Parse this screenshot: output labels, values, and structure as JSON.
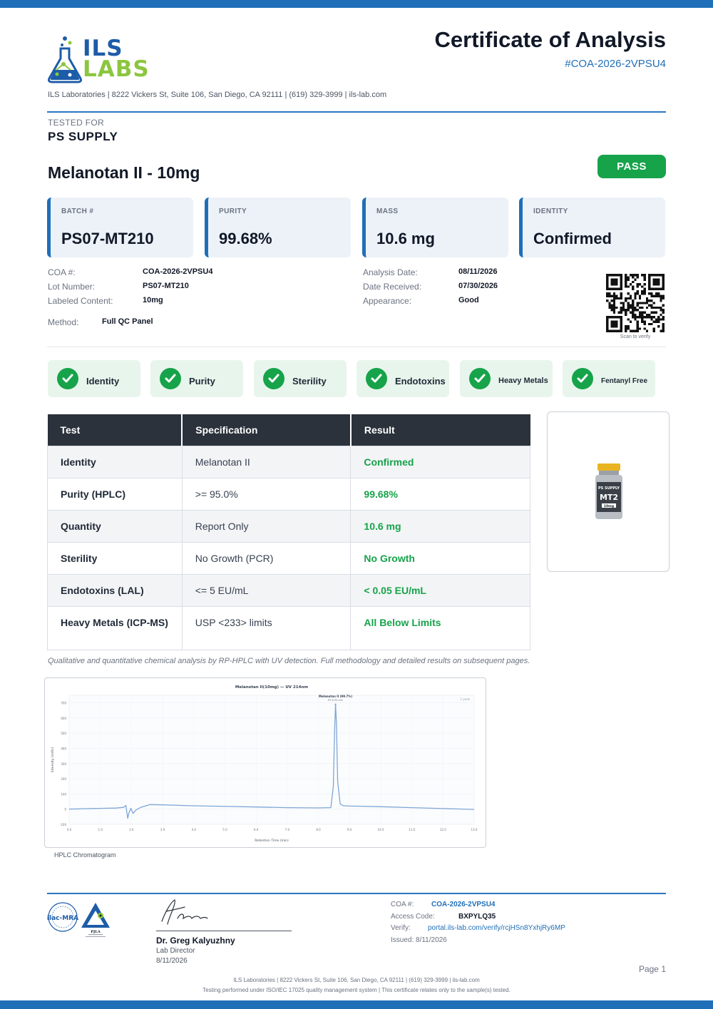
{
  "header": {
    "logo_primary": "ILS",
    "logo_secondary": "LABS",
    "address_line": "ILS Laboratories  |  8222 Vickers St, Suite 106, San Diego, CA 92111  |  (619) 329-3999  |  ils-lab.com",
    "title": "Certificate of Analysis",
    "coa_number": "#COA-2026-2VPSU4"
  },
  "client": {
    "label": "TESTED FOR",
    "name": "PS SUPPLY"
  },
  "product": {
    "name": "Melanotan II - 10mg",
    "status": "PASS"
  },
  "summary_cards": [
    {
      "label": "BATCH #",
      "value": "PS07-MT210"
    },
    {
      "label": "PURITY",
      "value": "99.68%"
    },
    {
      "label": "MASS",
      "value": "10.6 mg"
    },
    {
      "label": "IDENTITY",
      "value": "Confirmed"
    }
  ],
  "details_left": [
    {
      "key": "COA #:",
      "value": "COA-2026-2VPSU4"
    },
    {
      "key": "Lot Number:",
      "value": "PS07-MT210"
    },
    {
      "key": "Labeled Content:",
      "value": "10mg"
    }
  ],
  "method": {
    "key": "Method:",
    "value": "Full QC Panel"
  },
  "details_right": [
    {
      "key": "Analysis Date:",
      "value": "08/11/2026"
    },
    {
      "key": "Date Received:",
      "value": "07/30/2026"
    },
    {
      "key": "Appearance:",
      "value": "Good"
    }
  ],
  "qr_caption": "Scan to verify",
  "checks": [
    "Identity",
    "Purity",
    "Sterility",
    "Endotoxins",
    "Heavy Metals",
    "Fentanyl Free"
  ],
  "results_table": {
    "headers": [
      "Test",
      "Specification",
      "Result"
    ],
    "rows": [
      {
        "test": "Identity",
        "spec": "Melanotan II",
        "result": "Confirmed"
      },
      {
        "test": "Purity (HPLC)",
        "spec": ">= 95.0%",
        "result": "99.68%"
      },
      {
        "test": "Quantity",
        "spec": "Report Only",
        "result": "10.6 mg"
      },
      {
        "test": "Sterility",
        "spec": "No Growth (PCR)",
        "result": "No Growth"
      },
      {
        "test": "Endotoxins (LAL)",
        "spec": "<= 5 EU/mL",
        "result": "< 0.05 EU/mL"
      },
      {
        "test": "Heavy Metals (ICP-MS)",
        "spec": "USP <233> limits",
        "result": "All Below Limits"
      }
    ]
  },
  "vial": {
    "brand": "PS SUPPLY",
    "code": "MT2",
    "dose": "10mg"
  },
  "footnote": "Qualitative and quantitative chemical analysis by RP-HPLC with UV detection. Full methodology and detailed results on subsequent pages.",
  "chromatogram": {
    "caption": "HPLC Chromatogram",
    "chart_data": {
      "type": "line",
      "title": "Melanotan II(10mg) — UV 214nm",
      "xlabel": "Retention Time (min)",
      "ylabel": "Intensity (mAU)",
      "xlim": [
        0,
        13
      ],
      "ylim": [
        -100,
        750
      ],
      "x_ticks": [
        "0.0",
        "1.0",
        "2.0",
        "3.0",
        "4.0",
        "5.0",
        "6.0",
        "7.0",
        "8.0",
        "9.0",
        "10.0",
        "11.0",
        "12.0",
        "13.0"
      ],
      "y_ticks": [
        "-100",
        "0",
        "100",
        "200",
        "300",
        "400",
        "500",
        "600",
        "700"
      ],
      "legend": "1 peak",
      "peak_label": "Melanotan II (99.7%)",
      "peak_sublabel": "RT 8.55 min",
      "x": [
        0.0,
        0.5,
        1.0,
        1.5,
        1.75,
        1.82,
        1.88,
        1.92,
        1.98,
        2.05,
        2.15,
        2.3,
        2.6,
        3.0,
        4.0,
        5.0,
        6.0,
        7.0,
        8.0,
        8.4,
        8.48,
        8.52,
        8.55,
        8.58,
        8.62,
        8.7,
        8.8,
        9.0,
        10.0,
        11.0,
        12.0,
        13.0
      ],
      "y": [
        0,
        3,
        5,
        7,
        12,
        25,
        -60,
        -25,
        5,
        -28,
        -5,
        12,
        30,
        28,
        22,
        18,
        14,
        10,
        8,
        10,
        150,
        520,
        690,
        560,
        180,
        35,
        22,
        20,
        16,
        10,
        4,
        -2
      ]
    }
  },
  "signature": {
    "name": "Dr. Greg Kalyuzhny",
    "role": "Lab Director",
    "date": "8/11/2026"
  },
  "accreditation": {
    "left_mark": "ilac-MRA",
    "right_mark": "PJLA"
  },
  "footer_info": {
    "coa_key": "COA #:",
    "coa_val": "COA-2026-2VPSU4",
    "access_key": "Access Code:",
    "access_val": "BXPYLQ35",
    "verify_key": "Verify:",
    "verify_val": "portal.ils-lab.com/verify/rcjHSn8YxhjRy6MP",
    "issued": "Issued: 8/11/2026"
  },
  "page_number": "Page 1",
  "footer_line1": "ILS Laboratories  |  8222 Vickers St, Suite 106, San Diego, CA 92111  |  (619) 329-3999  |  ils-lab.com",
  "footer_line2": "Testing performed under ISO/IEC 17025 quality management system  |  This certificate relates only to the sample(s) tested.",
  "colors": {
    "brand_blue": "#1f6fb8",
    "pass_green": "#16a34a",
    "header_dark": "#2b323b"
  }
}
